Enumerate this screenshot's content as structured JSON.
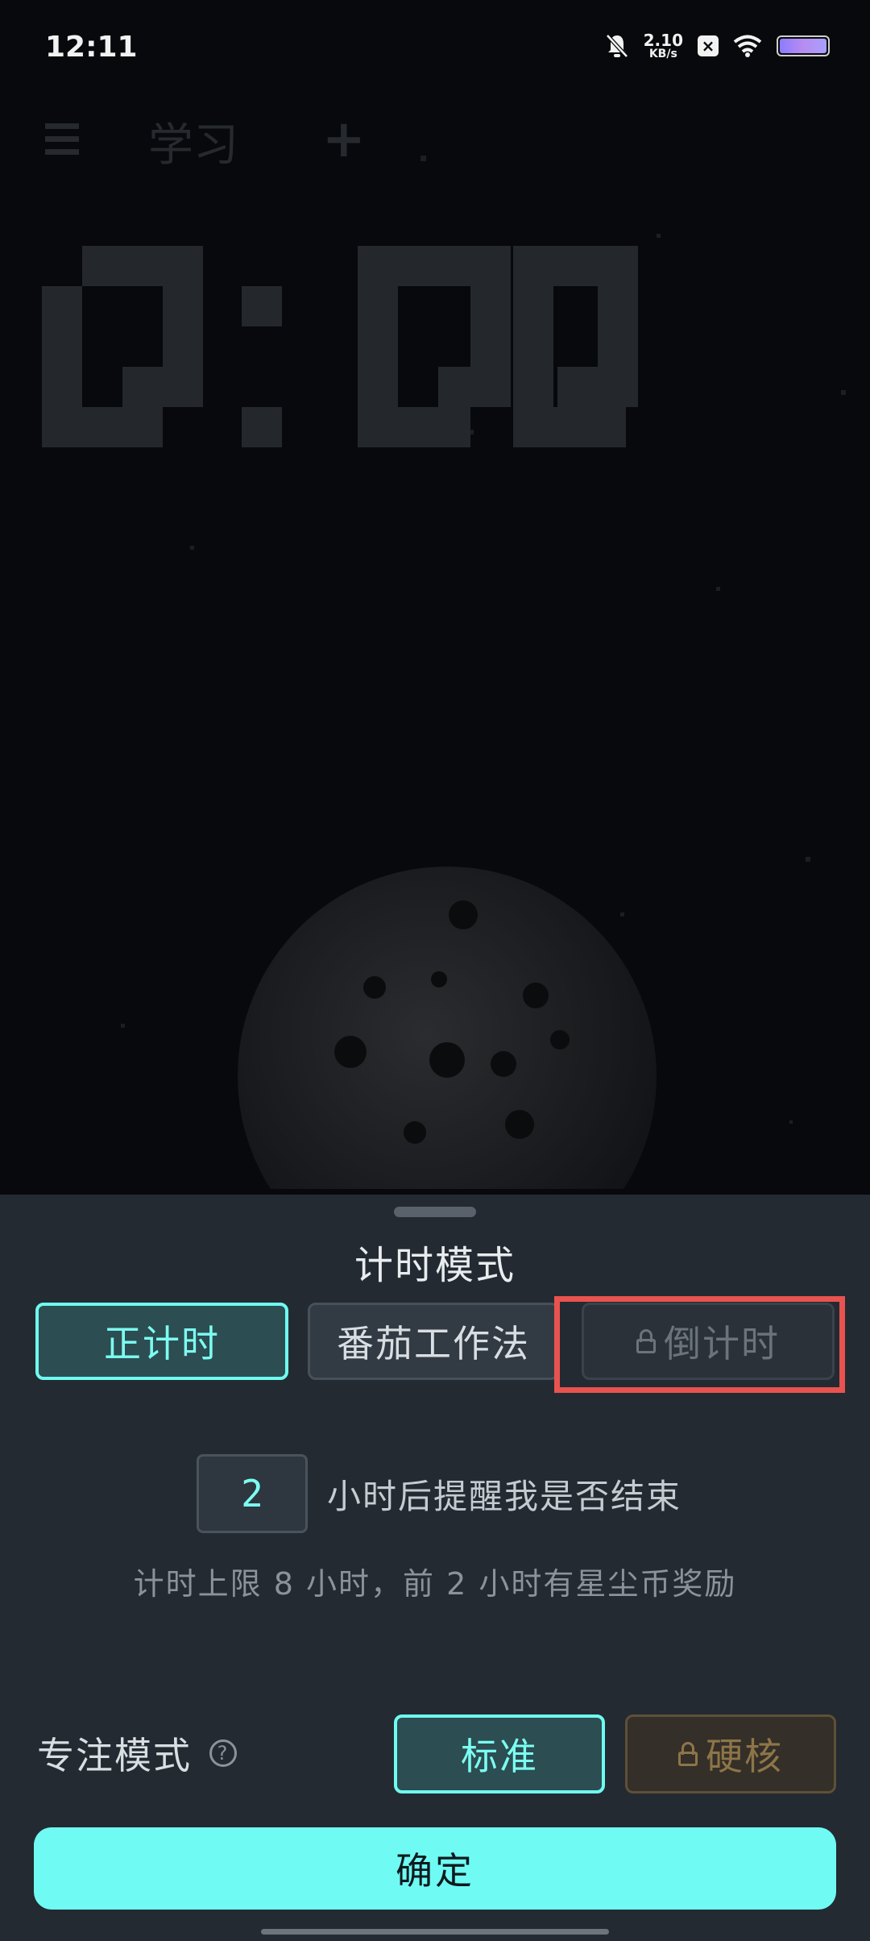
{
  "status_bar": {
    "time": "12:11",
    "net_speed_value": "2.10",
    "net_speed_unit": "KB/s",
    "battery_level_percent": 100,
    "icons": [
      "bell-off-icon",
      "x-app-icon",
      "wifi-icon",
      "battery-icon"
    ]
  },
  "top_nav": {
    "menu_icon": "menu-icon",
    "tag_name": "学习",
    "add_icon": "plus-icon"
  },
  "timer": {
    "display": "0:00"
  },
  "sheet": {
    "title": "计时模式",
    "modes": [
      {
        "label": "正计时",
        "state": "selected"
      },
      {
        "label": "番茄工作法",
        "state": "normal"
      },
      {
        "label": "倒计时",
        "state": "locked"
      }
    ],
    "reminder": {
      "hours_value": "2",
      "suffix": "小时后提醒我是否结束"
    },
    "limit_note": "计时上限 8 小时，前 2 小时有星尘币奖励",
    "focus": {
      "label": "专注模式",
      "help_icon": "question-circle-icon",
      "options": [
        {
          "label": "标准",
          "state": "selected"
        },
        {
          "label": "硬核",
          "state": "locked"
        }
      ]
    },
    "confirm_label": "确定"
  },
  "colors": {
    "accent": "#6ffbf0",
    "sheet_bg": "#232a31",
    "highlight": "#e8534f",
    "locked_gold": "#8d7548"
  }
}
